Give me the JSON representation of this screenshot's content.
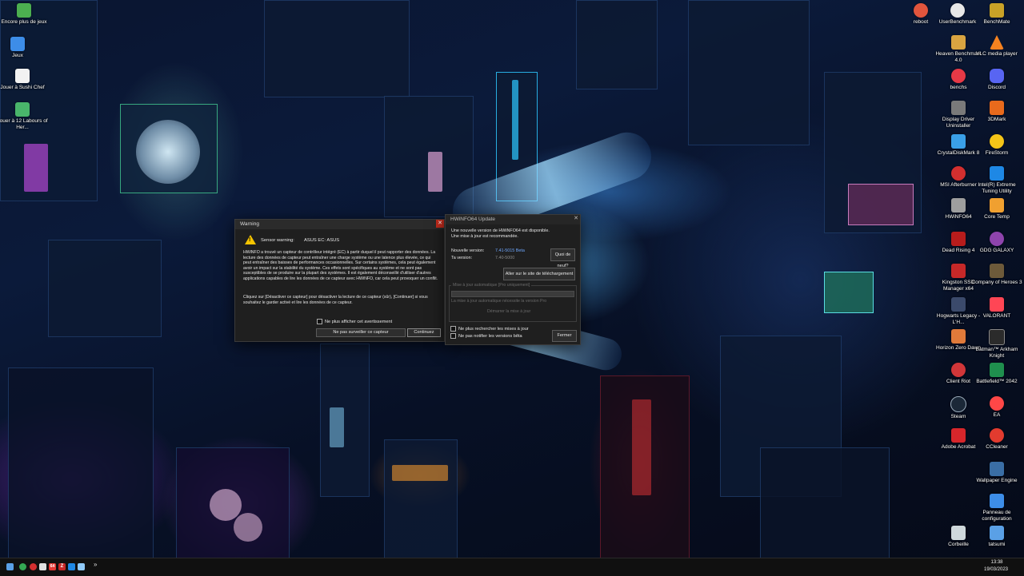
{
  "desktop": {
    "left_icons": [
      {
        "label": "Encore plus de jeux",
        "icon": "games-folder-icon",
        "color": "#4caf50"
      },
      {
        "label": "Jeux",
        "icon": "games-icon",
        "color": "#3d8de8"
      },
      {
        "label": "Jouer à Sushi Chef",
        "icon": "sushi-chef-icon",
        "color": "#f2f2f2"
      },
      {
        "label": "Jouer à 12 Labours of Her...",
        "icon": "labours-icon",
        "color": "#49b56b"
      }
    ],
    "right_icons": [
      {
        "label": "reboot",
        "icon": "reboot-icon",
        "color": "#e2553d"
      },
      {
        "label": "UserBenchmark",
        "icon": "userbenchmark-icon",
        "color": "#e8e8e8"
      },
      {
        "label": "BenchMate",
        "icon": "benchmate-icon",
        "color": "#c9a227"
      },
      {
        "label": "Heaven Benchmark 4.0",
        "icon": "heaven-icon",
        "color": "#d9a441"
      },
      {
        "label": "VLC media player",
        "icon": "vlc-icon",
        "color": "#f58220"
      },
      {
        "label": "benchs",
        "icon": "benchs-icon",
        "color": "#e63946"
      },
      {
        "label": "Discord",
        "icon": "discord-icon",
        "color": "#5865f2"
      },
      {
        "label": "Display Driver Uninstaller",
        "icon": "ddu-icon",
        "color": "#7a7a7a"
      },
      {
        "label": "3DMark",
        "icon": "3dmark-icon",
        "color": "#e86a1c"
      },
      {
        "label": "CrystalDiskMark 8",
        "icon": "crystaldiskmark-icon",
        "color": "#3aa0e8"
      },
      {
        "label": "FireStorm",
        "icon": "firestorm-icon",
        "color": "#f5c518"
      },
      {
        "label": "MSI Afterburner",
        "icon": "afterburner-icon",
        "color": "#d32f2f"
      },
      {
        "label": "Intel(R) Extreme Tuning Utility",
        "icon": "xtu-icon",
        "color": "#1e88e5"
      },
      {
        "label": "HWiNFO64",
        "icon": "hwinfo-icon",
        "color": "#9e9e9e"
      },
      {
        "label": "Core Temp",
        "icon": "coretemp-icon",
        "color": "#f0a030"
      },
      {
        "label": "Dead Rising 4",
        "icon": "deadrising-icon",
        "color": "#b71c1c"
      },
      {
        "label": "GDG GALAXY",
        "icon": "galaxy-icon",
        "color": "#8e44ad"
      },
      {
        "label": "Kingston SSD Manager x64",
        "icon": "kingston-icon",
        "color": "#c62828"
      },
      {
        "label": "Company of Heroes 3",
        "icon": "coh3-icon",
        "color": "#6d5a3a"
      },
      {
        "label": "Hogwarts Legacy - L'H...",
        "icon": "hogwarts-icon",
        "color": "#3b4a6b"
      },
      {
        "label": "VALORANT",
        "icon": "valorant-icon",
        "color": "#ff4655"
      },
      {
        "label": "Horizon Zero Dawn",
        "icon": "horizon-icon",
        "color": "#e07a3a"
      },
      {
        "label": "Batman™ Arkham Knight",
        "icon": "batman-icon",
        "color": "#2b2b2b"
      },
      {
        "label": "Client Riot",
        "icon": "riot-icon",
        "color": "#d13639"
      },
      {
        "label": "Battlefield™ 2042",
        "icon": "battlefield-icon",
        "color": "#1f8f4e"
      },
      {
        "label": "Steam",
        "icon": "steam-icon",
        "color": "#1b2838"
      },
      {
        "label": "EA",
        "icon": "ea-icon",
        "color": "#ff4747"
      },
      {
        "label": "Adobe Acrobat",
        "icon": "acrobat-icon",
        "color": "#d7262b"
      },
      {
        "label": "CCleaner",
        "icon": "ccleaner-icon",
        "color": "#e23b2f"
      },
      {
        "label": "Wallpaper Engine",
        "icon": "wallpaper-engine-icon",
        "color": "#3a6ea5"
      },
      {
        "label": "Panneau de configuration",
        "icon": "control-panel-icon",
        "color": "#3d8de8"
      },
      {
        "label": "Corbeille",
        "icon": "recycle-bin-icon",
        "color": "#cfd8dc"
      },
      {
        "label": "tatsumi",
        "icon": "user-folder-icon",
        "color": "#5aa0e6"
      }
    ]
  },
  "warning_dialog": {
    "title": "Warning",
    "sensor_label": "Sensor warning:",
    "sensor_value": "ASUS EC: ASUS",
    "body": "HWiNFO a trouvé un capteur de contrôleur intégré (EC) à partir duquel il peut rapporter des données. La lecture des données de capteur peut entraîner une charge système ou une latence plus élevée, ce qui peut entraîner des baisses de performances occasionnelles. Sur certains systèmes, cela peut également avoir un impact sur la stabilité du système. Ces effets sont spécifiques au système et ne sont pas susceptibles de se produire sur la plupart des systèmes. Il est également déconseillé d'utiliser d'autres applications capables de lire les données de ce capteur avec HWiNFO, car cela peut provoquer un conflit.",
    "body2": "Cliquez sur [Désactiver ce capteur] pour désactiver la lecture de ce capteur (sûr), [Continuer] si vous souhaitez le garder activé et lire les données de ce capteur.",
    "checkbox_label": "Ne plus afficher cet avertissement",
    "disable_button": "Ne pas surveiller ce capteur",
    "continue_button": "Continuez"
  },
  "update_dialog": {
    "title": "HWiNFO64 Update",
    "message_line1": "Une nouvelle version de HWiNFO64 est disponible.",
    "message_line2": "Une mise à jour est recommandée.",
    "new_version_label": "Nouvelle version:",
    "new_version_value": "7.41-5015 Beta",
    "your_version_label": "Ta version:",
    "your_version_value": "7.40-5000",
    "whats_new_button": "Quoi de neuf?",
    "download_button": "Aller sur le site de téléchargement",
    "auto_update_group": "Mise à jour automatique [Pro uniquement]",
    "auto_update_note": "La mise à jour automatique nécessite la version Pro",
    "start_update_button": "Démarrer la mise à jour",
    "checkbox_no_updates": "Ne plus rechercher les mises à jour",
    "checkbox_no_beta": "Ne pas notifier les versions bêta",
    "close_button": "Fermer"
  },
  "taskbar": {
    "time": "13:38",
    "date": "19/03/2023",
    "overflow_label": "»",
    "icons": [
      {
        "name": "start-icon",
        "color": "#5aa0e6"
      },
      {
        "name": "chrome-icon",
        "color": "#34a853"
      },
      {
        "name": "afterburner-tray-icon",
        "color": "#d32f2f"
      },
      {
        "name": "hwinfo-tray-icon",
        "color": "#e0e0e0"
      },
      {
        "name": "64-badge-icon",
        "color": "#e53935"
      },
      {
        "name": "z-icon",
        "color": "#c62828"
      },
      {
        "name": "app-blue-icon",
        "color": "#1e88e5"
      },
      {
        "name": "network-icon",
        "color": "#90caf9"
      }
    ]
  }
}
